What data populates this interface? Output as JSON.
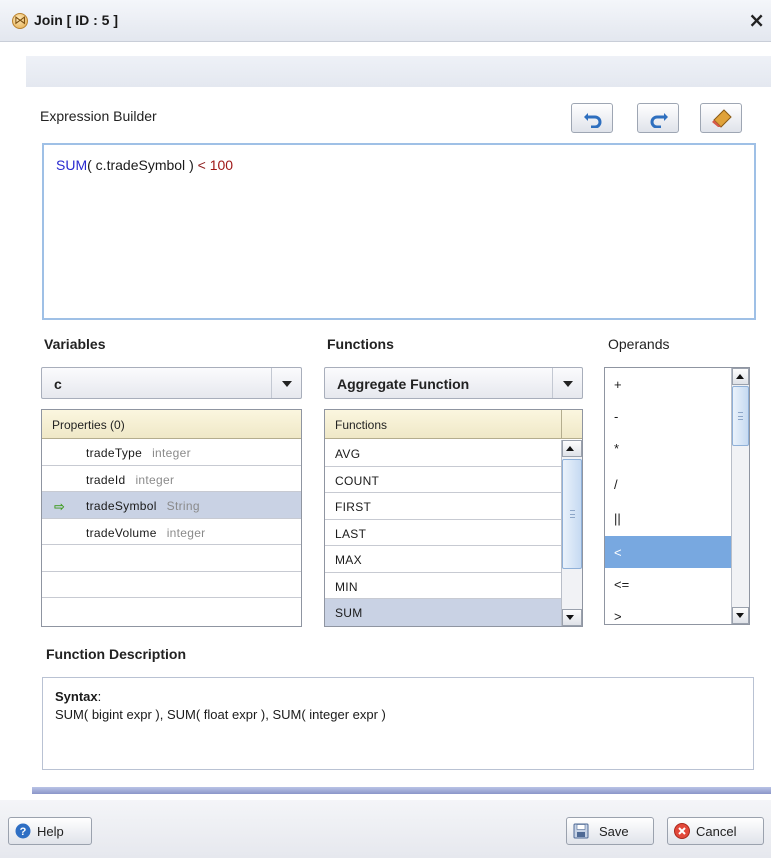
{
  "window": {
    "title": "Join [ ID : 5 ]",
    "close_glyph": "×"
  },
  "expression_builder": {
    "label": "Expression Builder",
    "tools": [
      {
        "name": "undo-icon"
      },
      {
        "name": "redo-icon"
      },
      {
        "name": "eraser-icon"
      }
    ],
    "expression": {
      "func": "SUM",
      "open": "(",
      "arg": " c.tradeSymbol ",
      "close": ")",
      "operator": " < ",
      "value": "100"
    }
  },
  "variables": {
    "label": "Variables",
    "selected": "c",
    "header": "Properties (0)",
    "rows": [
      {
        "name": "tradeType",
        "type": "integer",
        "selected": false
      },
      {
        "name": "tradeId",
        "type": "integer",
        "selected": false
      },
      {
        "name": "tradeSymbol",
        "type": "String",
        "selected": true
      },
      {
        "name": "tradeVolume",
        "type": "integer",
        "selected": false
      }
    ],
    "selected_marker": "⇨"
  },
  "functions": {
    "label": "Functions",
    "selected": "Aggregate Function",
    "header": "Functions",
    "items": [
      "AVG",
      "COUNT",
      "FIRST",
      "LAST",
      "MAX",
      "MIN",
      "SUM"
    ],
    "selected_item": "SUM"
  },
  "operands": {
    "label": "Operands",
    "items": [
      "+",
      "-",
      "*",
      "/",
      "||",
      "<",
      "<=",
      ">"
    ],
    "selected_item": "<"
  },
  "function_description": {
    "label": "Function Description",
    "syntax_label": "Syntax",
    "syntax_colon": ":",
    "syntax_text": "SUM( bigint expr ), SUM( float expr ), SUM( integer expr )"
  },
  "footer": {
    "help_label": "Help",
    "save_label": "Save",
    "cancel_label": "Cancel"
  },
  "colors": {
    "keyword": "#2a2ad0",
    "number": "#a01818",
    "selection": "#78a8e0",
    "editor_border": "#9fc0e6"
  }
}
